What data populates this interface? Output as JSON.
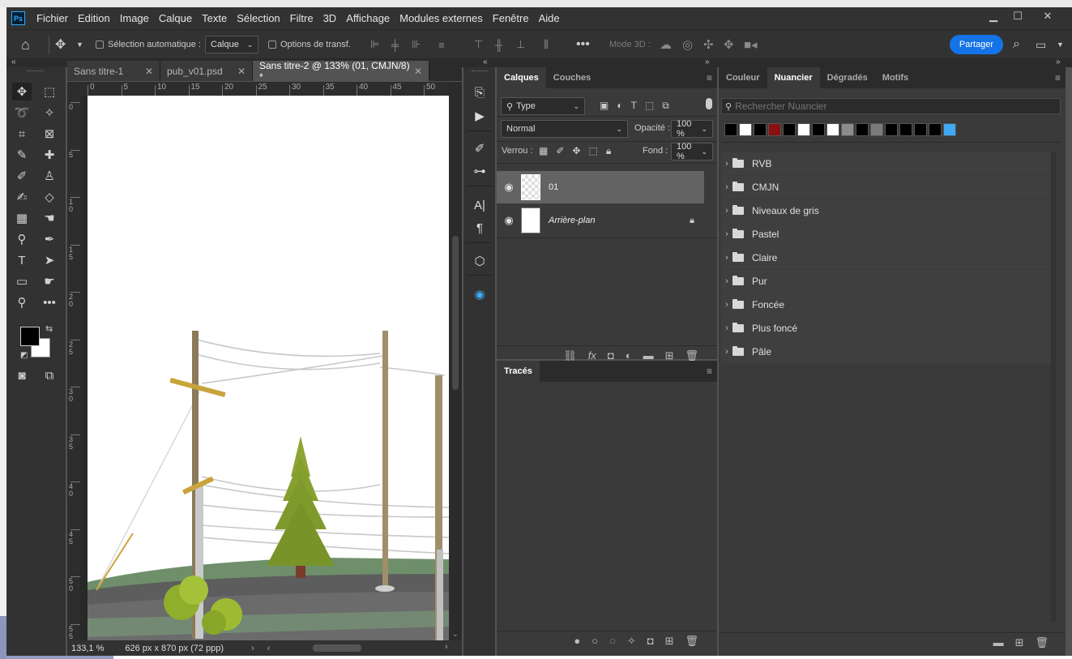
{
  "app": {
    "logo": "Ps"
  },
  "menu": [
    "Fichier",
    "Edition",
    "Image",
    "Calque",
    "Texte",
    "Sélection",
    "Filtre",
    "3D",
    "Affichage",
    "Modules externes",
    "Fenêtre",
    "Aide"
  ],
  "options": {
    "auto_select_label": "Sélection automatique :",
    "auto_select_value": "Calque",
    "transform_label": "Options de transf.",
    "mode3d_label": "Mode 3D :",
    "share_label": "Partager"
  },
  "tabs": [
    {
      "label": "Sans titre-1",
      "active": false
    },
    {
      "label": "pub_v01.psd",
      "active": false
    },
    {
      "label": "Sans titre-2 @ 133% (01, CMJN/8) *",
      "active": true
    }
  ],
  "rulers": {
    "h": [
      "0",
      "5",
      "10",
      "15",
      "20",
      "25",
      "30",
      "35",
      "40",
      "45",
      "50"
    ],
    "v": [
      "0",
      "5",
      "1 0",
      "1 5",
      "2 0",
      "2 5",
      "3 0",
      "3 5",
      "4 0",
      "4 5",
      "5 0",
      "5 5"
    ]
  },
  "status": {
    "zoom": "133,1 %",
    "doc": "626 px x 870 px (72 ppp)"
  },
  "layers_panel": {
    "tabs": [
      "Calques",
      "Couches"
    ],
    "filter": "Type",
    "blend_mode": "Normal",
    "opacity_label": "Opacité :",
    "opacity_value": "100 %",
    "lock_label": "Verrou :",
    "fill_label": "Fond :",
    "fill_value": "100 %",
    "layers": [
      {
        "name": "01",
        "selected": true
      },
      {
        "name": "Arrière-plan",
        "selected": false,
        "locked": true
      }
    ]
  },
  "paths_panel": {
    "tabs": [
      "Tracés"
    ]
  },
  "swatches_panel": {
    "tabs": [
      "Couleur",
      "Nuancier",
      "Dégradés",
      "Motifs"
    ],
    "search_placeholder": "Rechercher Nuancier",
    "recent_colors": [
      "#000000",
      "#ffffff",
      "#000000",
      "#8b0f0f",
      "#000000",
      "#ffffff",
      "#000000",
      "#ffffff",
      "#8c8c8c",
      "#000000",
      "#7a7a7a",
      "#000000",
      "#000000",
      "#000000",
      "#000000",
      "#3fa9f5"
    ],
    "groups": [
      "RVB",
      "CMJN",
      "Niveaux de gris",
      "Pastel",
      "Claire",
      "Pur",
      "Foncée",
      "Plus foncé",
      "Pâle"
    ]
  }
}
